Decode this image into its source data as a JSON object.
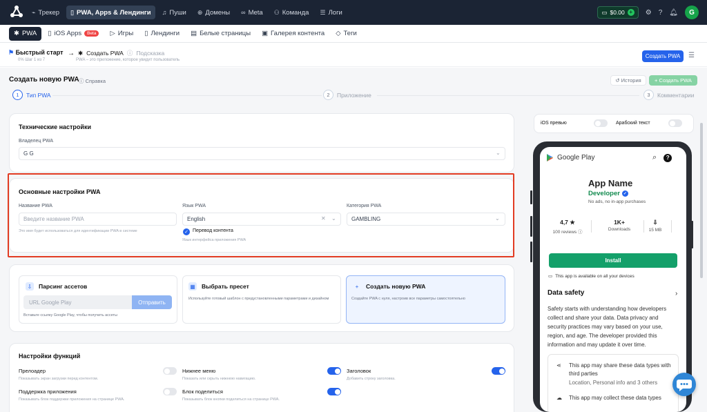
{
  "topnav": {
    "items": [
      {
        "icon": "chart-icon",
        "label": "Трекер"
      },
      {
        "icon": "phone-icon",
        "label": "PWA, Apps & Лендинги",
        "active": true
      },
      {
        "icon": "bell-icon",
        "label": "Пуши"
      },
      {
        "icon": "globe-icon",
        "label": "Домены"
      },
      {
        "icon": "meta-icon",
        "label": "Meta"
      },
      {
        "icon": "team-icon",
        "label": "Команда"
      },
      {
        "icon": "list-icon",
        "label": "Логи"
      }
    ],
    "balance": "$0.00",
    "avatar": "G"
  },
  "subnav": {
    "items": [
      {
        "label": "PWA",
        "active": true
      },
      {
        "label": "iOS Apps",
        "badge": "Beta"
      },
      {
        "label": "Игры"
      },
      {
        "label": "Лендинги"
      },
      {
        "label": "Белые страницы"
      },
      {
        "label": "Галерея контента"
      },
      {
        "label": "Теги"
      }
    ]
  },
  "breadcrumb": {
    "quick_start": "Быстрый старт",
    "progress": "0%  Шаг 1 из 7",
    "create_pwa": "Создать PWA",
    "hint": "Подсказка",
    "hint_sub": "PWA – это приложение, которое увидит пользователь",
    "create_button": "Создать PWA"
  },
  "page": {
    "title": "Создать новую PWA",
    "help": "Справка",
    "history": "История",
    "create": "Создать PWA"
  },
  "steps": [
    {
      "num": "1",
      "label": "Тип PWA"
    },
    {
      "num": "2",
      "label": "Приложение"
    },
    {
      "num": "3",
      "label": "Комментарии"
    }
  ],
  "tech": {
    "title": "Технические настройки",
    "owner_label": "Владелец PWA",
    "owner_value": "G G"
  },
  "basic": {
    "title": "Основные настройки PWA",
    "name_label": "Название PWA",
    "name_placeholder": "Введите название PWA",
    "name_hint": "Это имя будет использоваться для идентификации PWA в системе",
    "lang_label": "Язык PWA",
    "lang_value": "English",
    "translate_label": "Перевод контента",
    "lang_hint": "Язык интерфейса приложения PWA",
    "cat_label": "Категория PWA",
    "cat_value": "GAMBLING"
  },
  "options": [
    {
      "title": "Парсинг ассетов",
      "desc": "Вставьте ссылку Google Play, чтобы получить ассеты"
    },
    {
      "title": "Выбрать пресет",
      "desc": "Используйте готовый шаблон с предустановленными параметрами и дизайном"
    },
    {
      "title": "Создать новую PWA",
      "desc": "Создайте PWA с нуля, настроив все параметры самостоятельно"
    }
  ],
  "url_placeholder": "URL Google Play",
  "send_label": "Отправить",
  "features": {
    "title": "Настройки функций",
    "items": [
      {
        "label": "Прелоадер",
        "desc": "Показывать экран загрузки перед контентом.",
        "on": false
      },
      {
        "label": "Нижнее меню",
        "desc": "Показать или скрыть нижнюю навигацию.",
        "on": true
      },
      {
        "label": "Заголовок",
        "desc": "Добавить строку заголовка.",
        "on": true
      },
      {
        "label": "Поддержка приложения",
        "desc": "Показывать блок поддержки приложения на странице PWA.",
        "on": false
      },
      {
        "label": "Блок поделиться",
        "desc": "Показывать блок кнопки поделиться на странице PWA.",
        "on": true
      }
    ]
  },
  "preview": {
    "ios_label": "iOS превью",
    "ios_on": false,
    "arabic_label": "Арабский текст",
    "arabic_on": false
  },
  "phone": {
    "store": "Google Play",
    "app_name": "App Name",
    "developer": "Developer",
    "noads": "No ads, no in-app purchases",
    "rating": "4,7 ★",
    "reviews": "100 reviews ⓘ",
    "downloads_v": "1K+",
    "downloads_l": "Downloads",
    "size_v": "15 MB",
    "install": "Install",
    "available": "This app is available on all your devices",
    "data_safety": "Data safety",
    "ds_text": "Safety starts with understanding how developers collect and share your data. Data privacy and security practices may vary based on your use, region, and age. The developer provided this information and may update it over time.",
    "share_title": "This app may share these data types with third parties",
    "share_sub": "Location, Personal info and 3 others",
    "collect_title": "This app may collect these data types"
  },
  "colors": {
    "accent": "#2563eb",
    "topbar": "#1b2434",
    "install": "#14a06a",
    "highlight": "#e23b22"
  }
}
